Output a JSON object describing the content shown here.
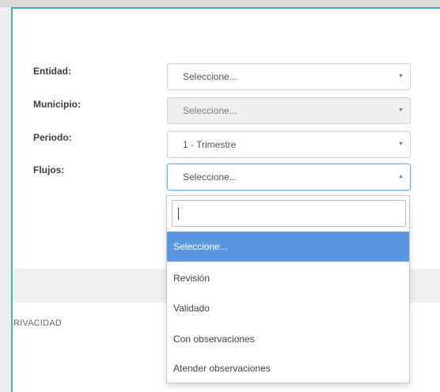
{
  "form": {
    "entidad": {
      "label": "Entidad:",
      "value": "Seleccione..."
    },
    "municipio": {
      "label": "Municipio:",
      "value": "Seleccione..."
    },
    "periodo": {
      "label": "Periodo:",
      "value": "1 - Trimestre"
    },
    "flujos": {
      "label": "Flujos:",
      "value": "Seleccione..."
    }
  },
  "dropdown": {
    "search_value": "",
    "options": [
      {
        "label": "Seleccione...",
        "selected": true
      },
      {
        "label": "Revisión",
        "selected": false
      },
      {
        "label": "Validado",
        "selected": false
      },
      {
        "label": "Con observaciones",
        "selected": false
      },
      {
        "label": "Atender observaciones",
        "selected": false
      }
    ]
  },
  "footer": {
    "privacy_text": "RIVACIDAD"
  },
  "colors": {
    "accent": "#3ab5ad",
    "highlight": "#5b97e0"
  },
  "icons": {
    "caret_down": "chevron-down-icon",
    "caret_up": "chevron-up-icon"
  }
}
